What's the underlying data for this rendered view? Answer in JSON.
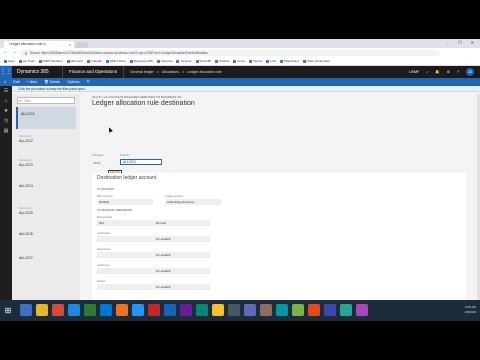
{
  "browser": {
    "tab_title": "Ledger allocation rule d…",
    "tab_close": "×",
    "window_buttons": "–  ❐  ✕",
    "nav_glyphs": "← → ⟳",
    "url": "Secure  https://d365demo11706bd0f3d9b15d40aos.cloudax.dynamics.com/?cmp=USMF&mi=LedgerAllocationRuleDestination",
    "bookmarks": [
      "Apps",
      "AX Tools",
      "D365 Sandbox",
      "Microsoft",
      "LinkedIn",
      "MSFT Docs",
      "Dynamics 365",
      "Lifecycle",
      "Yammer",
      "PowerBI",
      "Outlook",
      "Azure",
      "Teams",
      "LCS",
      "SharePoint",
      "Other bookmarks"
    ]
  },
  "app_header": {
    "waffle": "⋮⋮",
    "brand": "Dynamics 365",
    "module": "Finance and Operations",
    "breadcrumbs": [
      "General ledger",
      ">",
      "Allocations",
      ">",
      "Ledger allocation rule"
    ],
    "company": "USMF",
    "icons": [
      "⌕",
      "🔔",
      "⚙",
      "?"
    ],
    "avatar": "JD"
  },
  "action_pane": {
    "search_glyph": "⌕",
    "items": [
      "Edit",
      "+ New",
      "🗑 Delete",
      "Options",
      "🔍"
    ]
  },
  "info_bar": "Click the pin button to keep the filter pane open.",
  "left_nav_icons": [
    "☰",
    "⌂",
    "★",
    "◷",
    "▤"
  ],
  "list_panel": {
    "filter_placeholder": "Filter",
    "filter_icon": "⌕",
    "items": [
      {
        "small": "",
        "value": "ALLOC1"
      },
      {
        "small": "Dimension",
        "value": "ALLOC2"
      },
      {
        "small": "Dimension",
        "value": "ALLOC3"
      },
      {
        "small": "",
        "value": "ALLOC4"
      },
      {
        "small": "Dimension",
        "value": "ALLOC5"
      },
      {
        "small": "",
        "value": "ALLOC6"
      },
      {
        "small": "",
        "value": "ALLOC7"
      }
    ]
  },
  "detail": {
    "subtitle": "ALLOC | ALLOCATE PURCHASED SERVICES TO BUSINESS UN",
    "title": "Ledger allocation rule destination",
    "company_label": "Company",
    "company_value": "usmf",
    "rule_label": "Rule ID",
    "rule_value": "ALLOC1",
    "tooltip": "ALLOC1",
    "card_title": "Destination ledger account",
    "account_section": "TO ACCOUNT",
    "main_account_label": "Main account",
    "main_account_value": "601100",
    "ledger_account_label": "Ledger account",
    "ledger_account_value": "Advertising Expense",
    "dims_section": "TO FINANCIAL DIMENSIONS",
    "dims": [
      {
        "label": "BusinessUnit",
        "value": "001",
        "right": "Normal"
      },
      {
        "label": "CostCenter",
        "value": "",
        "right": "Pro default"
      },
      {
        "label": "Department",
        "value": "",
        "right": "Pro default"
      },
      {
        "label": "ItemGroup",
        "value": "",
        "right": "Pro default"
      },
      {
        "label": "Project",
        "value": "",
        "right": "Pro default"
      }
    ]
  },
  "taskbar": {
    "start": "⊞",
    "icon_colors": [
      "#3d6fc2",
      "#e8b42a",
      "#d84b3a",
      "#1e88e5",
      "#2e7d32",
      "#0078d7",
      "#f2711c",
      "#2196f3",
      "#c62828",
      "#1565c0",
      "#6a1b9a",
      "#00897b",
      "#fbc02d",
      "#455a64",
      "#5c6bc0",
      "#8d6e63",
      "#0097a7",
      "#7cb342",
      "#e64a19",
      "#3949ab",
      "#26a69a",
      "#ab47bc"
    ],
    "time": "9:45 AM",
    "date": "1/8/2018"
  }
}
